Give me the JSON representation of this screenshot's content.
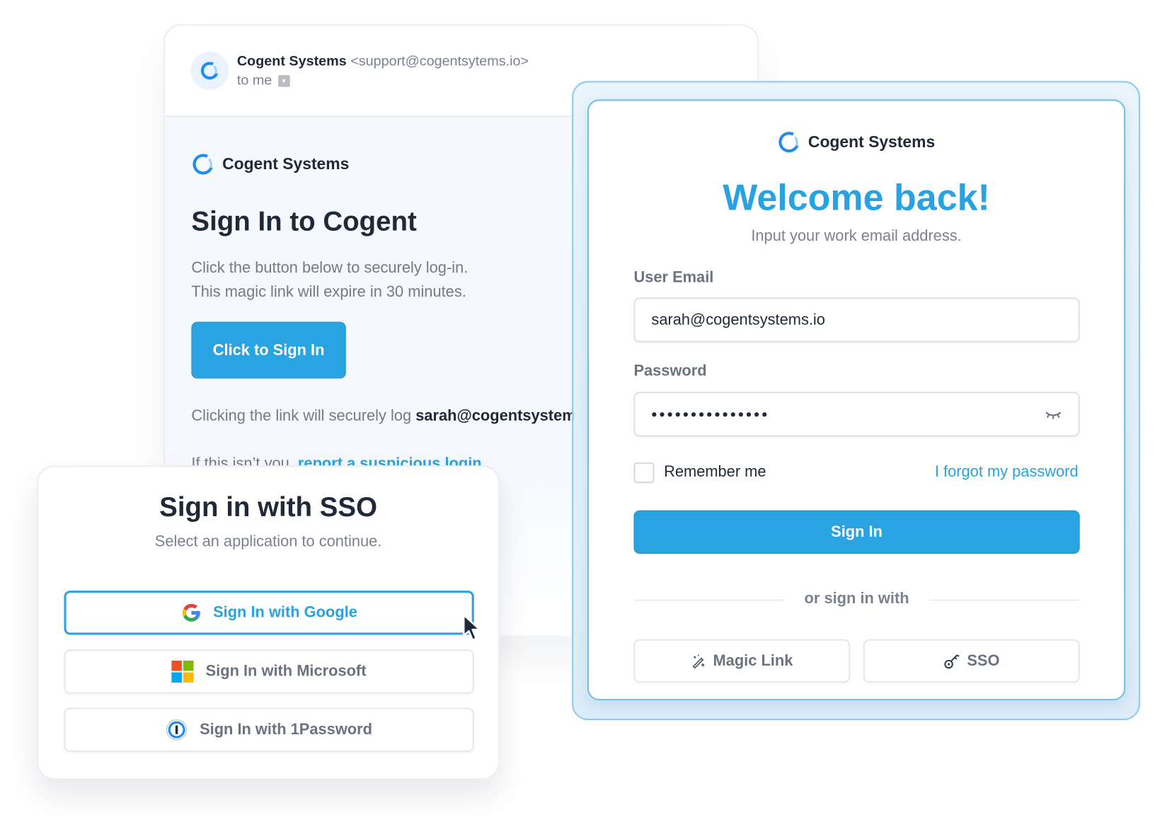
{
  "email": {
    "sender_name": "Cogent Systems",
    "sender_address": "<support@cogentsytems.io>",
    "recipient": "to me",
    "brand": "Cogent Systems",
    "title": "Sign In to Cogent",
    "line1": "Click the button below to securely log-in.",
    "line2": "This magic link will expire in 30 minutes.",
    "cta": "Click to Sign In",
    "login_note": "Clicking the link will securely log",
    "login_email": "sarah@cogentsystems.io",
    "not_you": "If this isn’t you,",
    "report_link": "report a suspicious login",
    "period": "."
  },
  "login": {
    "brand": "Cogent Systems",
    "title": "Welcome back!",
    "subtitle": "Input your work email address.",
    "email_label": "User Email",
    "email_value": "sarah@cogentsystems.io",
    "password_label": "Password",
    "password_mask": "•••••••••••••••",
    "remember": "Remember me",
    "remember_checked": false,
    "forgot": "I forgot my password",
    "sign_in": "Sign In",
    "divider": "or sign in with",
    "magic_link": "Magic Link",
    "sso": "SSO"
  },
  "sso": {
    "title": "Sign in with SSO",
    "subtitle": "Select an application to continue.",
    "google": "Sign In with Google",
    "microsoft": "Sign In with Microsoft",
    "onepassword": "Sign In with 1Password"
  },
  "colors": {
    "accent": "#29a3e1",
    "text": "#1f2937",
    "muted": "#747a86"
  }
}
